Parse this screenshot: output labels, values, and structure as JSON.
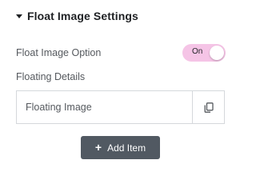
{
  "section": {
    "title": "Float Image Settings",
    "icon": "caret-down-icon"
  },
  "float_option": {
    "label": "Float Image Option",
    "switch_text": "On",
    "switch_state": true,
    "switch_color": "#f5c4e6"
  },
  "details": {
    "label": "Floating Details",
    "items": [
      {
        "title": "Floating Image",
        "action_icon": "duplicate-icon"
      }
    ]
  },
  "add_button": {
    "label": "Add Item",
    "icon": "plus-icon",
    "color": "#515962"
  }
}
